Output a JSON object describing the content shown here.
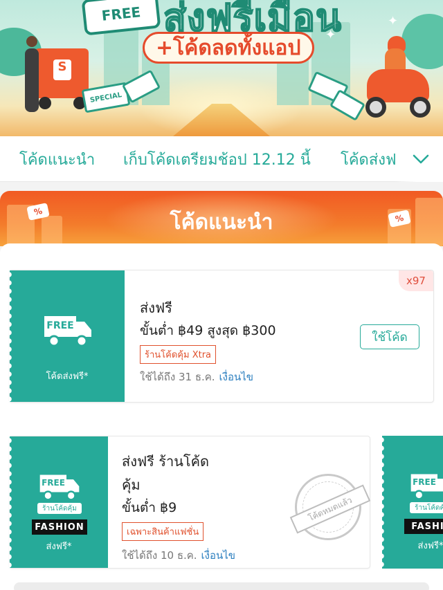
{
  "banner": {
    "free_badge": "FREE",
    "title": "ส่งฟรีเมื่อน",
    "title_star": "*",
    "subtitle": "+โค้ดลดทั้งแอป",
    "ticket_special": "SPECIAL"
  },
  "tabs": [
    {
      "label": "โค้ดแนะนำ"
    },
    {
      "label": "เก็บโค้ดเตรียมช้อป 12.12 นี้"
    },
    {
      "label": "โค้ดส่งฟ"
    }
  ],
  "section": {
    "title": "โค้ดแนะนำ",
    "percent_badge": "%"
  },
  "vouchers": [
    {
      "badge_text": "FREE",
      "left_label": "โค้ดส่งฟรี*",
      "title": "ส่งฟรี",
      "condition": "ขั้นต่ำ ฿49 สูงสุด ฿300",
      "tag": "ร้านโค้ดคุ้ม Xtra",
      "valid": "ใช้ได้ถึง 31 ธ.ค.",
      "terms": "เงื่อนไข",
      "button": "ใช้โค้ด",
      "quantity": "x97"
    },
    {
      "badge_text": "FREE",
      "mini_badge": "ร้านโค้ดคุ้ม",
      "brand": "FASHION",
      "left_label": "ส่งฟรี*",
      "title_line1": "ส่งฟรี ร้านโค้ด",
      "title_line2": "คุ้ม",
      "condition": "ขั้นต่ำ ฿9",
      "tag": "เฉพาะสินค้าแฟชั่น",
      "valid": "ใช้ได้ถึง 10 ธ.ค.",
      "terms": "เงื่อนไข",
      "stamp": "โค้ดหมดแล้ว"
    },
    {
      "badge_text": "FREE",
      "mini_badge": "ร้านโค้ดคุ้ม",
      "brand": "FASHIO",
      "left_label": "ส่งฟรี*"
    }
  ],
  "colors": {
    "accent": "#26aa99",
    "orange": "#f15a24",
    "tag_red": "#e0502c",
    "link": "#2c7fbf"
  }
}
